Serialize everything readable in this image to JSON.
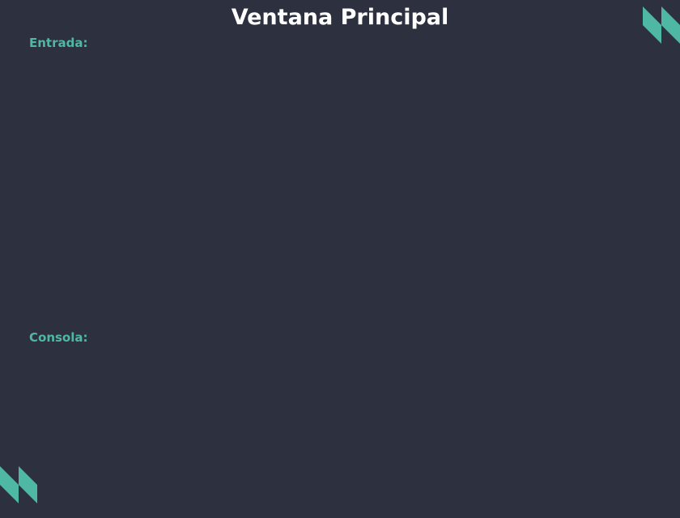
{
  "window": {
    "title": "Ventana Principal"
  },
  "input_section": {
    "label": "Entrada:",
    "value": ""
  },
  "console_section": {
    "label": "Consola:",
    "value": ""
  },
  "colors": {
    "background": "#2d303f",
    "accent": "#4fb8a4",
    "title": "#ffffff"
  },
  "icons": {
    "top_right": "triangle-pattern-icon",
    "bottom_left": "triangle-pattern-icon"
  }
}
